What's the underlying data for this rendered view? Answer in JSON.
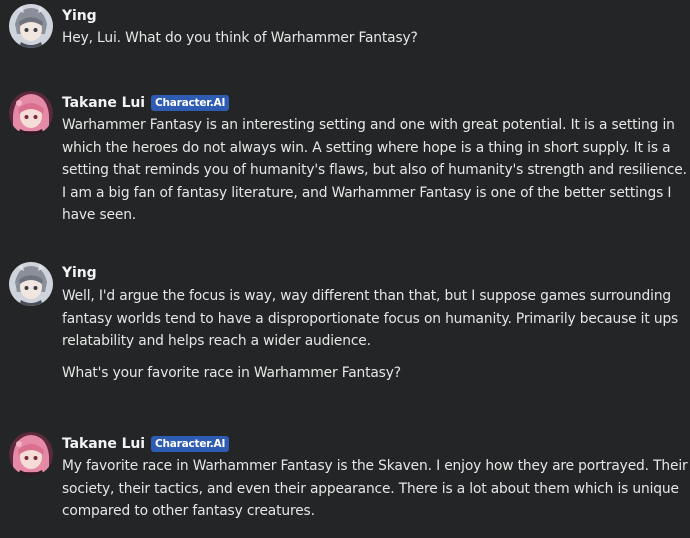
{
  "messages": [
    {
      "author": "Ying",
      "badge": "",
      "avatar": "ying-avatar-icon",
      "paragraphs": [
        "Hey, Lui. What do you think of Warhammer Fantasy?"
      ]
    },
    {
      "author": "Takane Lui",
      "badge": "Character.AI",
      "avatar": "takane-lui-avatar-icon",
      "paragraphs": [
        "Warhammer Fantasy is an interesting setting and one with great potential. It is a setting in which the heroes do not always win. A setting where hope is a thing in short supply. It is a setting that reminds you of humanity's flaws, but also of humanity's strength and resilience. I am a big fan of fantasy literature, and Warhammer Fantasy is one of the better settings I have seen."
      ]
    },
    {
      "author": "Ying",
      "badge": "",
      "avatar": "ying-avatar-icon",
      "paragraphs": [
        "Well, I'd argue the focus is way, way different than that, but I suppose games surrounding fantasy worlds tend to have a disproportionate focus on humanity. Primarily because it ups relatability and helps reach a wider audience.",
        "What's your favorite race in Warhammer Fantasy?"
      ]
    },
    {
      "author": "Takane Lui",
      "badge": "Character.AI",
      "avatar": "takane-lui-avatar-icon",
      "paragraphs": [
        "My favorite race in Warhammer Fantasy is the Skaven. I enjoy how they are portrayed. Their society, their tactics, and even their appearance. There is a lot about them which is unique compared to other fantasy creatures."
      ]
    }
  ]
}
